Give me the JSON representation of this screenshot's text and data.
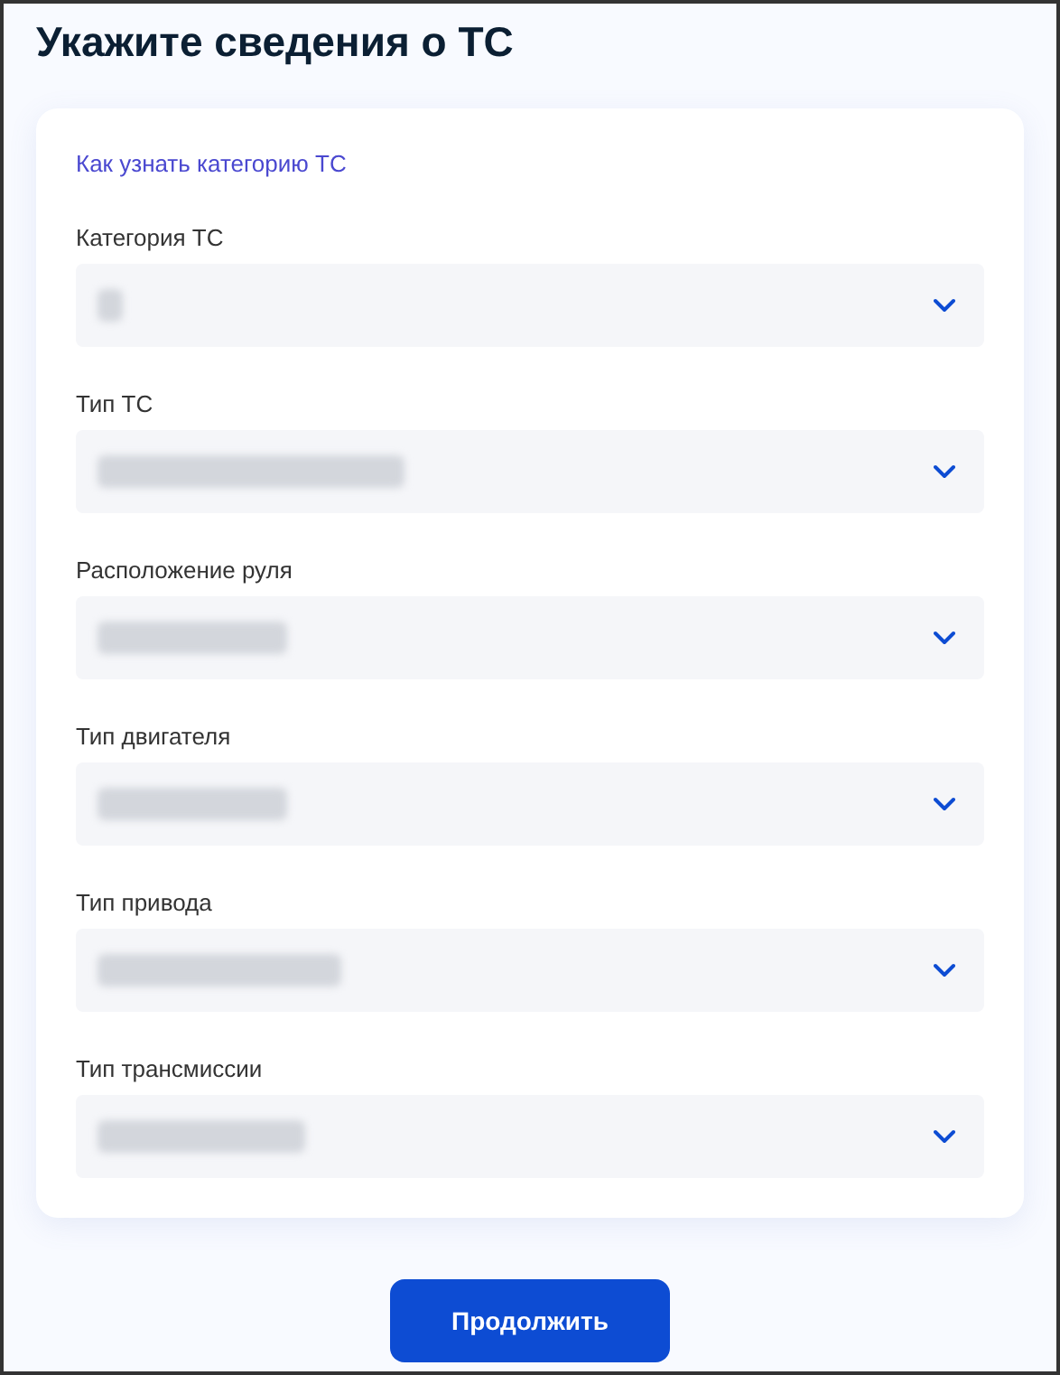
{
  "title": "Укажите сведения о ТС",
  "help_link": "Как узнать категорию ТС",
  "fields": [
    {
      "label": "Категория ТС",
      "redacted": true
    },
    {
      "label": "Тип ТС",
      "redacted": true
    },
    {
      "label": "Расположение руля",
      "redacted": true
    },
    {
      "label": "Тип двигателя",
      "redacted": true
    },
    {
      "label": "Тип привода",
      "redacted": true
    },
    {
      "label": "Тип трансмиссии",
      "redacted": true
    }
  ],
  "continue_button": "Продолжить"
}
